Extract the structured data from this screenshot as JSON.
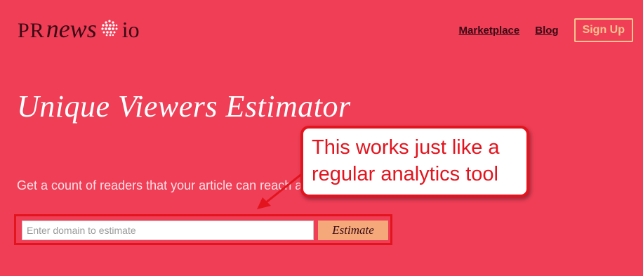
{
  "brand": {
    "pr": "PR",
    "news": "news",
    "io": "io"
  },
  "nav": {
    "marketplace": "Marketplace",
    "blog": "Blog",
    "signup": "Sign Up"
  },
  "page": {
    "title": "Unique Viewers Estimator",
    "description": "Get a count of readers that your article can reach all over the world."
  },
  "form": {
    "placeholder": "Enter domain to estimate",
    "button": "Estimate"
  },
  "annotation": {
    "line1": "This works just like a",
    "line2": "regular analytics tool"
  },
  "colors": {
    "background": "#ef3e56",
    "accent": "#f7c58f",
    "annotation_red": "#e3141e",
    "button": "#f5a97a"
  }
}
